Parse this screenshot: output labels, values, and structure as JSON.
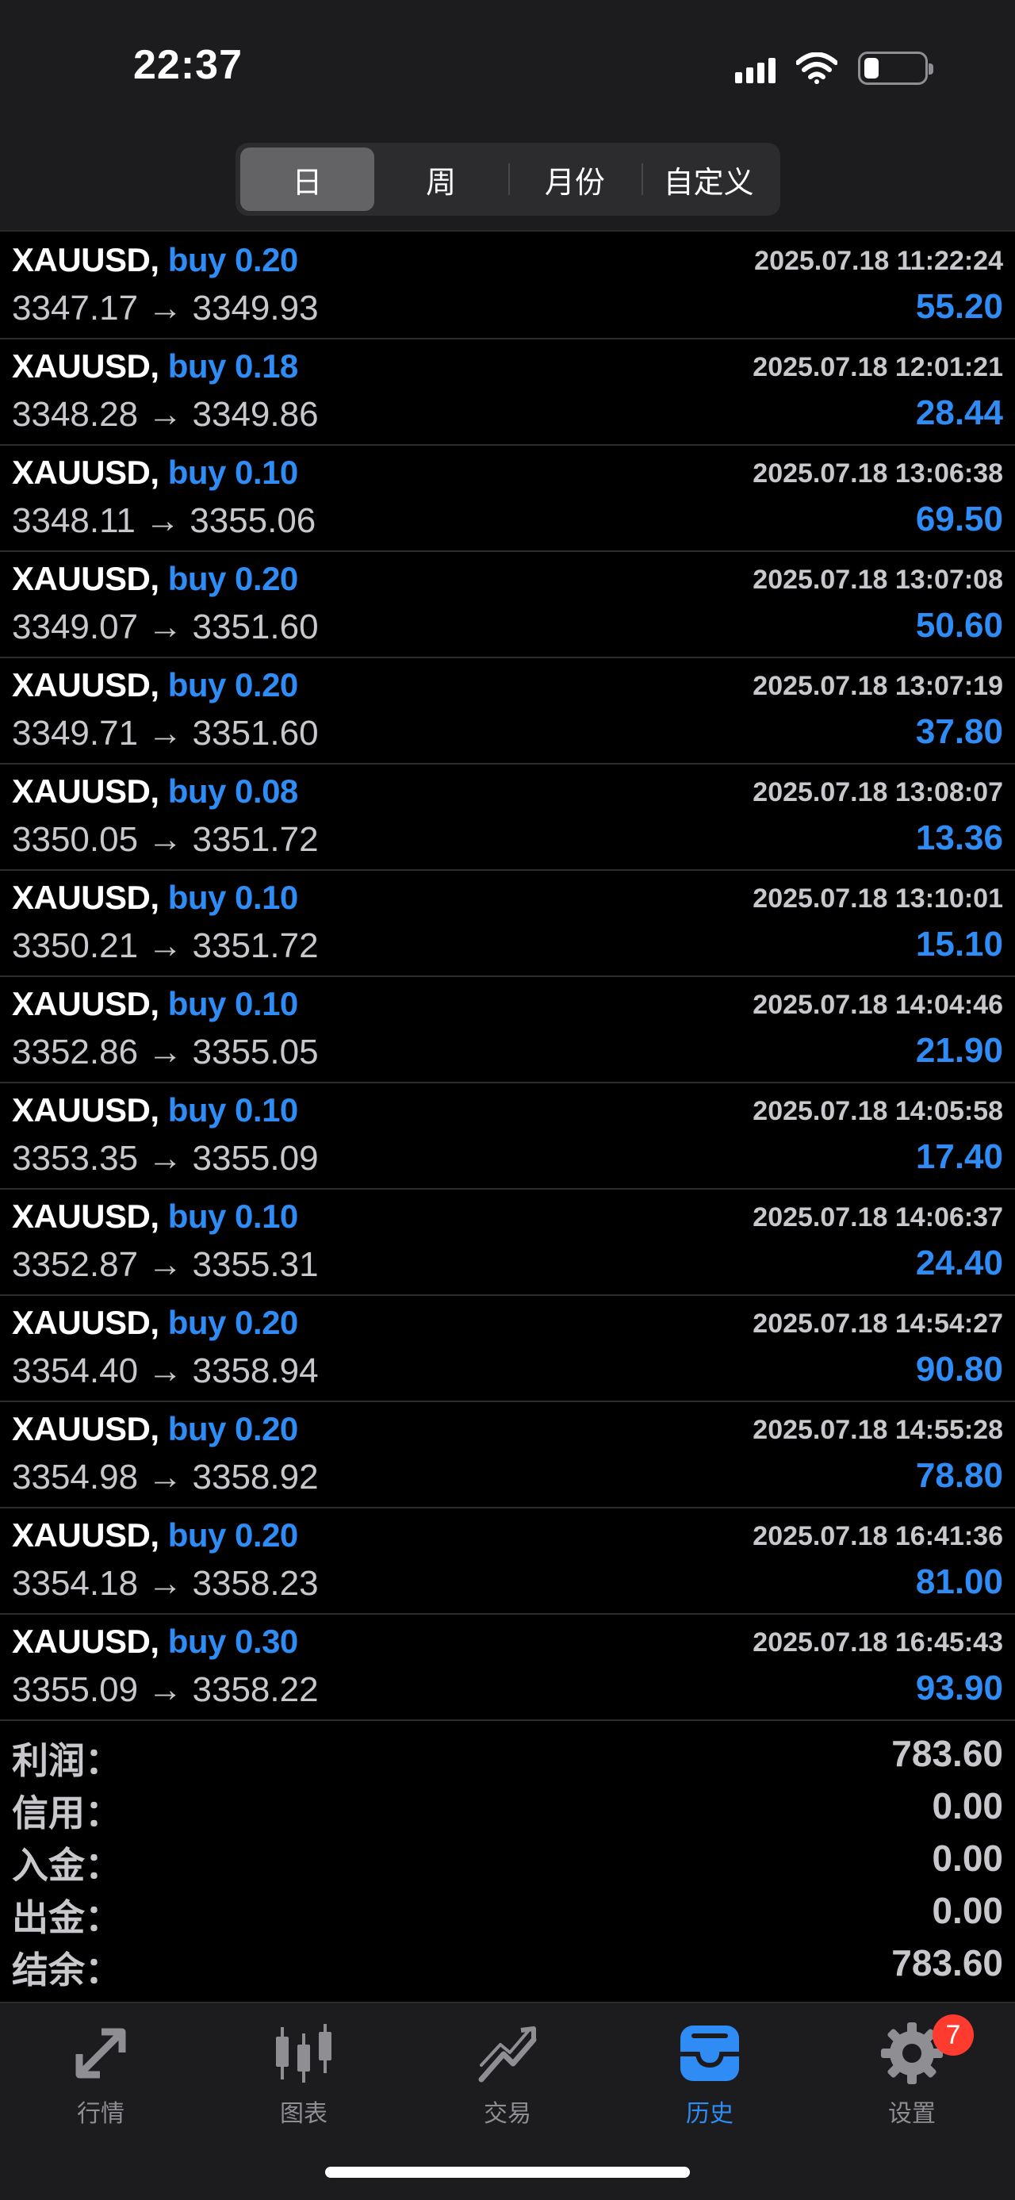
{
  "status": {
    "time": "22:37"
  },
  "period_tabs": [
    {
      "label": "日",
      "active": true
    },
    {
      "label": "周",
      "active": false
    },
    {
      "label": "月份",
      "active": false
    },
    {
      "label": "自定义",
      "active": false
    }
  ],
  "deals": [
    {
      "symbol": "XAUUSD,",
      "side": "buy 0.20",
      "time": "2025.07.18 11:22:24",
      "prices": "3347.17 → 3349.93",
      "profit": "55.20"
    },
    {
      "symbol": "XAUUSD,",
      "side": "buy 0.18",
      "time": "2025.07.18 12:01:21",
      "prices": "3348.28 → 3349.86",
      "profit": "28.44"
    },
    {
      "symbol": "XAUUSD,",
      "side": "buy 0.10",
      "time": "2025.07.18 13:06:38",
      "prices": "3348.11 → 3355.06",
      "profit": "69.50"
    },
    {
      "symbol": "XAUUSD,",
      "side": "buy 0.20",
      "time": "2025.07.18 13:07:08",
      "prices": "3349.07 → 3351.60",
      "profit": "50.60"
    },
    {
      "symbol": "XAUUSD,",
      "side": "buy 0.20",
      "time": "2025.07.18 13:07:19",
      "prices": "3349.71 → 3351.60",
      "profit": "37.80"
    },
    {
      "symbol": "XAUUSD,",
      "side": "buy 0.08",
      "time": "2025.07.18 13:08:07",
      "prices": "3350.05 → 3351.72",
      "profit": "13.36"
    },
    {
      "symbol": "XAUUSD,",
      "side": "buy 0.10",
      "time": "2025.07.18 13:10:01",
      "prices": "3350.21 → 3351.72",
      "profit": "15.10"
    },
    {
      "symbol": "XAUUSD,",
      "side": "buy 0.10",
      "time": "2025.07.18 14:04:46",
      "prices": "3352.86 → 3355.05",
      "profit": "21.90"
    },
    {
      "symbol": "XAUUSD,",
      "side": "buy 0.10",
      "time": "2025.07.18 14:05:58",
      "prices": "3353.35 → 3355.09",
      "profit": "17.40"
    },
    {
      "symbol": "XAUUSD,",
      "side": "buy 0.10",
      "time": "2025.07.18 14:06:37",
      "prices": "3352.87 → 3355.31",
      "profit": "24.40"
    },
    {
      "symbol": "XAUUSD,",
      "side": "buy 0.20",
      "time": "2025.07.18 14:54:27",
      "prices": "3354.40 → 3358.94",
      "profit": "90.80"
    },
    {
      "symbol": "XAUUSD,",
      "side": "buy 0.20",
      "time": "2025.07.18 14:55:28",
      "prices": "3354.98 → 3358.92",
      "profit": "78.80"
    },
    {
      "symbol": "XAUUSD,",
      "side": "buy 0.20",
      "time": "2025.07.18 16:41:36",
      "prices": "3354.18 → 3358.23",
      "profit": "81.00"
    },
    {
      "symbol": "XAUUSD,",
      "side": "buy 0.30",
      "time": "2025.07.18 16:45:43",
      "prices": "3355.09 → 3358.22",
      "profit": "93.90"
    }
  ],
  "summary": [
    {
      "label": "利润：",
      "value": "783.60"
    },
    {
      "label": "信用：",
      "value": "0.00"
    },
    {
      "label": "入金：",
      "value": "0.00"
    },
    {
      "label": "出金：",
      "value": "0.00"
    },
    {
      "label": "结余：",
      "value": "783.60"
    }
  ],
  "bottom_tabs": [
    {
      "label": "行情",
      "icon": "quotes-arrows-icon",
      "active": false
    },
    {
      "label": "图表",
      "icon": "candlestick-chart-icon",
      "active": false
    },
    {
      "label": "交易",
      "icon": "trade-trend-icon",
      "active": false
    },
    {
      "label": "历史",
      "icon": "history-inbox-icon",
      "active": true
    },
    {
      "label": "设置",
      "icon": "gear-icon",
      "active": false,
      "badge": "7"
    }
  ],
  "colors": {
    "accent": "#2f8cf5",
    "badge": "#ff3b30",
    "background": "#000000",
    "bar": "#1c1c1e"
  }
}
